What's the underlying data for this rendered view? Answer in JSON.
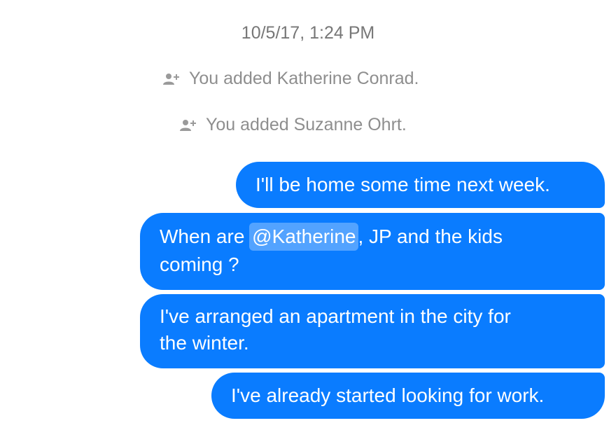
{
  "conversation": {
    "timestamp": "10/5/17, 1:24 PM",
    "events": [
      {
        "icon": "add-person-icon",
        "text": "You added Katherine Conrad."
      },
      {
        "icon": "add-person-icon",
        "text": "You added Suzanne Ohrt."
      }
    ],
    "messages": [
      {
        "lines": [
          "I'll be home some time next week."
        ]
      },
      {
        "before_mention": "When are ",
        "mention": "@Katherine",
        "after_mention": ", JP and the kids",
        "line2": "coming ?"
      },
      {
        "lines": [
          "I've arranged an apartment in the city for",
          "the winter."
        ]
      },
      {
        "lines": [
          "I've already started looking for work."
        ]
      }
    ]
  },
  "colors": {
    "bubble": "#0a7cff",
    "bubble_text": "#ffffff",
    "timestamp_text": "#777777",
    "event_text": "#8e8e8e"
  }
}
